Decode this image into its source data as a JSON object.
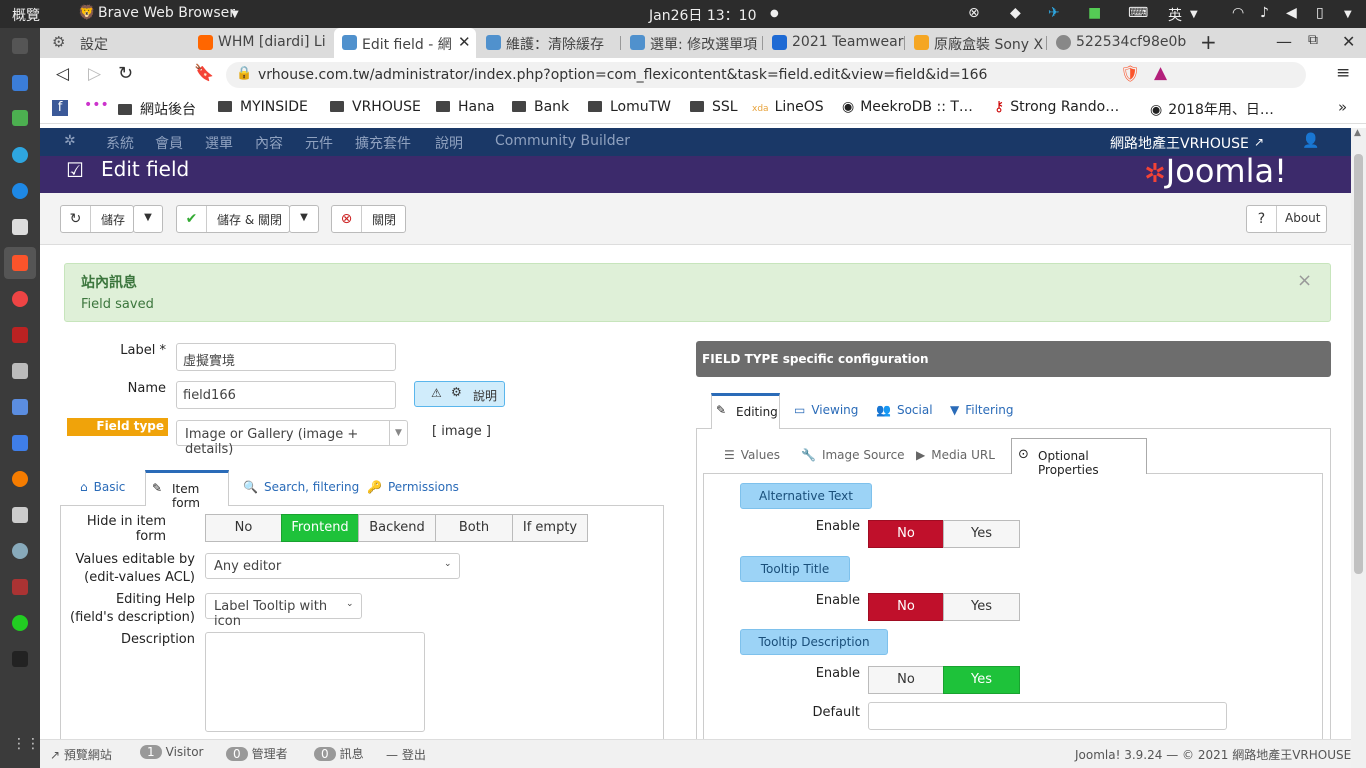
{
  "system": {
    "activities": "概覽",
    "app": "Brave Web Browser",
    "clock": "Jan26日 13：10",
    "ime": "英"
  },
  "tabs": [
    {
      "label": "設定"
    },
    {
      "label": "WHM [diardi] Li"
    },
    {
      "label": "Edit field - 網"
    },
    {
      "label": "維護：清除緩存"
    },
    {
      "label": "選單: 修改選單項"
    },
    {
      "label": "2021 Teamwear"
    },
    {
      "label": "原廠盒裝 Sony X"
    },
    {
      "label": "522534cf98e0b"
    }
  ],
  "address": {
    "url": "vrhouse.com.tw/administrator/index.php?option=com_flexicontent&task=field.edit&view=field&id=166"
  },
  "bookmarks": [
    "網站後台",
    "MYINSIDE",
    "VRHOUSE",
    "Hana",
    "Bank",
    "LomuTW",
    "SSL",
    "LineOS",
    "MeekroDB :: T…",
    "Strong Rando…",
    "2018年用、日…"
  ],
  "joomla": {
    "menu": [
      "系統",
      "會員",
      "選單",
      "內容",
      "元件",
      "擴充套件",
      "說明",
      "Community Builder"
    ],
    "site": "網路地產王VRHOUSE",
    "page_title": "Edit field",
    "brand": "Joomla!",
    "toolbar": {
      "save": "儲存",
      "save_close": "儲存 & 關閉",
      "close": "關閉",
      "about": "About"
    },
    "message": {
      "title": "站內訊息",
      "text": "Field saved"
    },
    "form": {
      "label_label": "Label *",
      "label_value": "虛擬實境",
      "name_label": "Name",
      "name_value": "field166",
      "help_button": "說明",
      "type_label": "Field type",
      "type_value": "Image or Gallery (image + details)",
      "type_tag": "[ image ]"
    },
    "left_tabs": [
      "Basic",
      "Item form",
      "Search, filtering",
      "Permissions"
    ],
    "item_form": {
      "hide_label": "Hide in item form",
      "hide_options": [
        "No",
        "Frontend",
        "Backend",
        "Both",
        "If empty"
      ],
      "hide_selected": "Frontend",
      "editable_label": "Values editable by",
      "editable_sub": "(edit-values ACL)",
      "editable_value": "Any editor",
      "help_label": "Editing Help",
      "help_sub": "(field's description)",
      "help_value": "Label Tooltip with icon",
      "desc_label": "Description"
    },
    "right": {
      "header": "FIELD TYPE specific configuration",
      "tabs": [
        "Editing",
        "Viewing",
        "Social",
        "Filtering"
      ],
      "subtabs": [
        "Values",
        "Image Source",
        "Media URL",
        "Optional Properties"
      ],
      "props": [
        {
          "title": "Alternative Text",
          "enable": "Enable",
          "no": "No",
          "yes": "Yes",
          "selected": "No"
        },
        {
          "title": "Tooltip Title",
          "enable": "Enable",
          "no": "No",
          "yes": "Yes",
          "selected": "No"
        },
        {
          "title": "Tooltip Description",
          "enable": "Enable",
          "no": "No",
          "yes": "Yes",
          "selected": "Yes"
        }
      ],
      "default_label": "Default"
    },
    "status": {
      "preview": "預覽網站",
      "visitors": "1",
      "visitors_label": "Visitor",
      "admins": "0",
      "admins_label": "管理者",
      "msgs": "0",
      "msgs_label": "訊息",
      "logout": "登出",
      "version": "Joomla! 3.9.24 — © 2021 網路地產王VRHOUSE"
    }
  }
}
